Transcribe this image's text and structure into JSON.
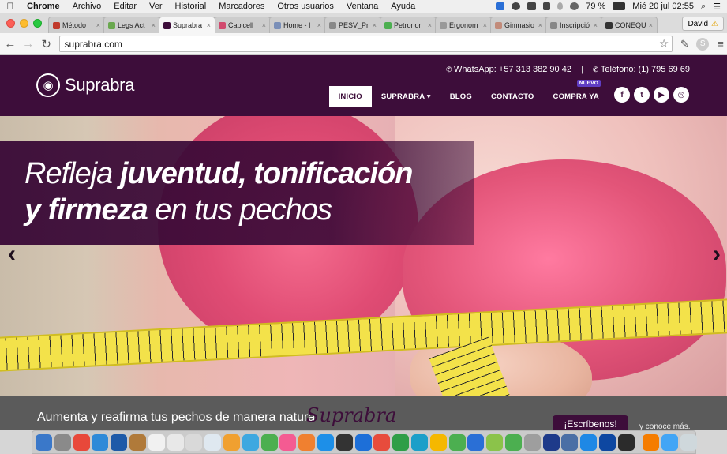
{
  "menubar": {
    "app": "Chrome",
    "items": [
      "Archivo",
      "Editar",
      "Ver",
      "Historial",
      "Marcadores",
      "Otros usuarios",
      "Ventana",
      "Ayuda"
    ],
    "battery": "79 %",
    "clock": "Mié 20 jul  02:55"
  },
  "tabs": [
    {
      "label": "Método",
      "fav": "#c0392b"
    },
    {
      "label": "Legs Act",
      "fav": "#6aa84f"
    },
    {
      "label": "Suprabra",
      "fav": "#3d0d3a"
    },
    {
      "label": "Capicell",
      "fav": "#d14a6e"
    },
    {
      "label": "Home - I",
      "fav": "#7a8fb8"
    },
    {
      "label": "PESV_Pr",
      "fav": "#888888"
    },
    {
      "label": "Petronor",
      "fav": "#4caf50"
    },
    {
      "label": "Ergonom",
      "fav": "#999999"
    },
    {
      "label": "Gimnasio",
      "fav": "#c28b7a"
    },
    {
      "label": "Inscripció",
      "fav": "#888888"
    },
    {
      "label": "CONEQU",
      "fav": "#333333"
    }
  ],
  "profile": {
    "name": "David"
  },
  "address": {
    "url": "suprabra.com"
  },
  "site": {
    "logo": "Suprabra",
    "whatsapp": "WhatsApp: +57 313 382 90 42",
    "separator": "|",
    "phone": "Teléfono: (1) 795 69 69",
    "nav": [
      "INICIO",
      "SUPRABRA ▾",
      "BLOG",
      "CONTACTO",
      "COMPRA YA"
    ],
    "badge": "NUEVO",
    "social": [
      "f",
      "t",
      "▶",
      "◎"
    ]
  },
  "hero": {
    "line1_a": "Refleja ",
    "line1_b": "juventud, tonificación",
    "line2_a": "y firmeza",
    "line2_b": " en tus pechos",
    "prev": "‹",
    "next": "›"
  },
  "band": {
    "claim": "Aumenta y reafirma tus pechos de manera natura",
    "script": "Suprabra",
    "cta": "¡Escríbenos!",
    "more": "y conoce más."
  },
  "dock": {
    "icons": [
      "#3a78c9",
      "#8a8a8a",
      "#e8483a",
      "#2e8ad8",
      "#1d5aa8",
      "#b07a3a",
      "#f1f1f1",
      "#e8e8e8",
      "#d9d9d9",
      "#dfe8f0",
      "#f0a030",
      "#3ea8e0",
      "#4caf50",
      "#f45b92",
      "#f08030",
      "#1d8fe8",
      "#333333",
      "#1d6fd8",
      "#e74c3c",
      "#2e9e47",
      "#1b9fc9",
      "#f5b800",
      "#4caf50",
      "#2a6fd6",
      "#8bc34a",
      "#4caf50",
      "#9e9e9e",
      "#1e3a8a",
      "#4a6fa5",
      "#1e88e5",
      "#0d47a1",
      "#2b2b2b",
      "#f57c00",
      "#42a5f5",
      "#cfd8dc"
    ]
  }
}
